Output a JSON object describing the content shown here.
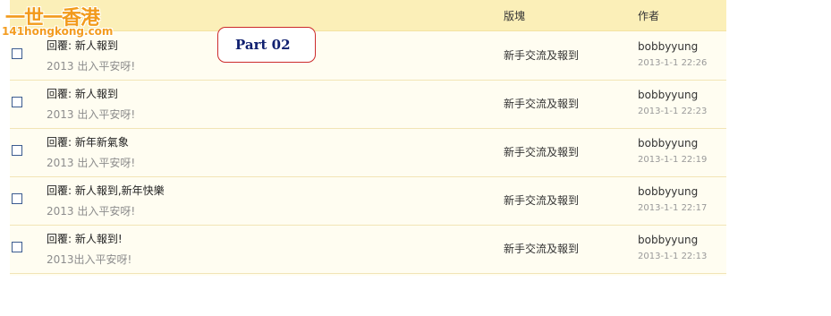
{
  "watermark": {
    "line1": "一世一香港",
    "line2": "141hongkong.com"
  },
  "header": {
    "board": "版塊",
    "author": "作者"
  },
  "callout": {
    "text": "Part  02"
  },
  "rows": [
    {
      "title": "回覆: 新人報到",
      "excerpt": "2013 出入平安呀!",
      "board": "新手交流及報到",
      "author": "bobbyyung",
      "datetime": "2013-1-1 22:26"
    },
    {
      "title": "回覆: 新人報到",
      "excerpt": "2013 出入平安呀!",
      "board": "新手交流及報到",
      "author": "bobbyyung",
      "datetime": "2013-1-1 22:23"
    },
    {
      "title": "回覆: 新年新氣象",
      "excerpt": "2013 出入平安呀!",
      "board": "新手交流及報到",
      "author": "bobbyyung",
      "datetime": "2013-1-1 22:19"
    },
    {
      "title": "回覆: 新人報到,新年快樂",
      "excerpt": "2013 出入平安呀!",
      "board": "新手交流及報到",
      "author": "bobbyyung",
      "datetime": "2013-1-1 22:17"
    },
    {
      "title": "回覆: 新人報到!",
      "excerpt": "2013出入平安呀!",
      "board": "新手交流及報到",
      "author": "bobbyyung",
      "datetime": "2013-1-1 22:13"
    }
  ],
  "colors": {
    "header_bg": "#fbefb8",
    "row_bg": "#fffdf1",
    "row_border": "#f2e5b6",
    "callout_border": "#cc2b2b",
    "callout_text": "#102070",
    "watermark": "#f29a1b"
  }
}
